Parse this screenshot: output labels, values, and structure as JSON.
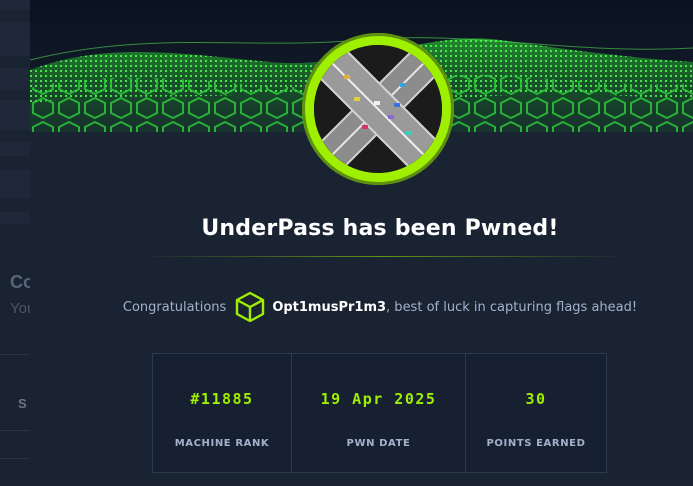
{
  "background": {
    "heading_fragment": "Co",
    "sub_fragment": "You",
    "button_fragment": "S"
  },
  "modal": {
    "title": "UnderPass has been Pwned!",
    "congrats_lead": "Congratulations",
    "username": "Opt1musPr1m3",
    "congrats_tail": ", best of luck in capturing flags ahead!",
    "badge_icon": "hex-cube-icon",
    "avatar_icon": "highway-interchange-image",
    "stats": [
      {
        "value": "#11885",
        "label": "MACHINE RANK"
      },
      {
        "value": "19 Apr 2025",
        "label": "PWN DATE"
      },
      {
        "value": "30",
        "label": "POINTS EARNED"
      }
    ]
  },
  "colors": {
    "accent": "#9fef00",
    "background": "#1a2332",
    "muted_text": "#a4b1cd",
    "border": "#2c3a4f"
  }
}
